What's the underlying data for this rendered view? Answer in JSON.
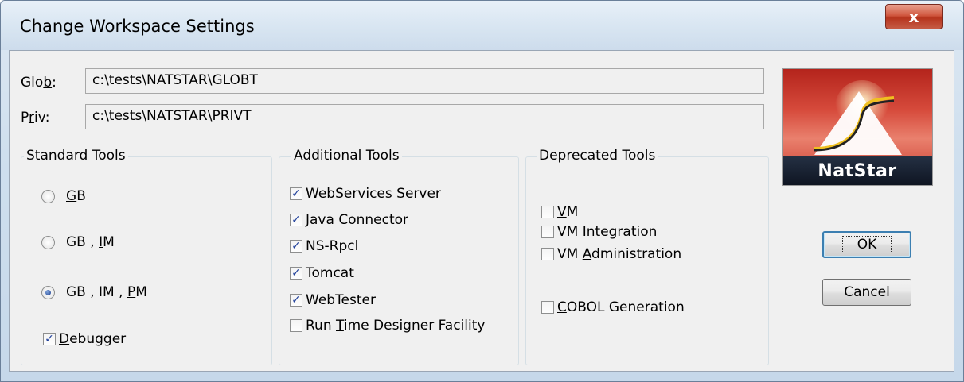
{
  "window": {
    "title": "Change Workspace Settings",
    "close_symbol": "x"
  },
  "paths": {
    "glob": {
      "label_pre": "Glo",
      "label_mnemonic": "b",
      "label_post": ":",
      "value": "c:\\tests\\NATSTAR\\GLOBT"
    },
    "priv": {
      "label_pre": "P",
      "label_mnemonic": "r",
      "label_post": "iv:",
      "value": "c:\\tests\\NATSTAR\\PRIVT"
    }
  },
  "standard_tools": {
    "title": "Standard Tools",
    "options": [
      {
        "parts": [
          "",
          "G",
          "B"
        ],
        "selected": false
      },
      {
        "parts": [
          "GB , ",
          "I",
          "M"
        ],
        "selected": false
      },
      {
        "parts": [
          "GB , IM , ",
          "P",
          "M"
        ],
        "selected": true
      }
    ],
    "debugger": {
      "parts": [
        "",
        "D",
        "ebugger"
      ],
      "checked": true
    }
  },
  "additional_tools": {
    "title": "Additional Tools",
    "items": [
      {
        "label": "WebServices Server",
        "checked": true
      },
      {
        "label": "Java Connector",
        "checked": true
      },
      {
        "label": "NS-Rpcl",
        "checked": true
      },
      {
        "label": "Tomcat",
        "checked": true
      },
      {
        "label": "WebTester",
        "checked": true
      },
      {
        "parts": [
          "Run ",
          "T",
          "ime Designer Facility"
        ],
        "checked": false
      }
    ]
  },
  "deprecated_tools": {
    "title": "Deprecated Tools",
    "items": [
      {
        "parts": [
          "",
          "V",
          "M"
        ],
        "checked": false
      },
      {
        "parts": [
          "VM I",
          "n",
          "tegration"
        ],
        "checked": false
      },
      {
        "parts": [
          "VM ",
          "A",
          "dministration"
        ],
        "checked": false
      },
      {
        "parts": [
          "",
          "C",
          "OBOL Generation"
        ],
        "checked": false
      }
    ]
  },
  "buttons": {
    "ok": "OK",
    "cancel": "Cancel"
  },
  "logo": {
    "text": "NatStar"
  },
  "check_symbol": "✓"
}
